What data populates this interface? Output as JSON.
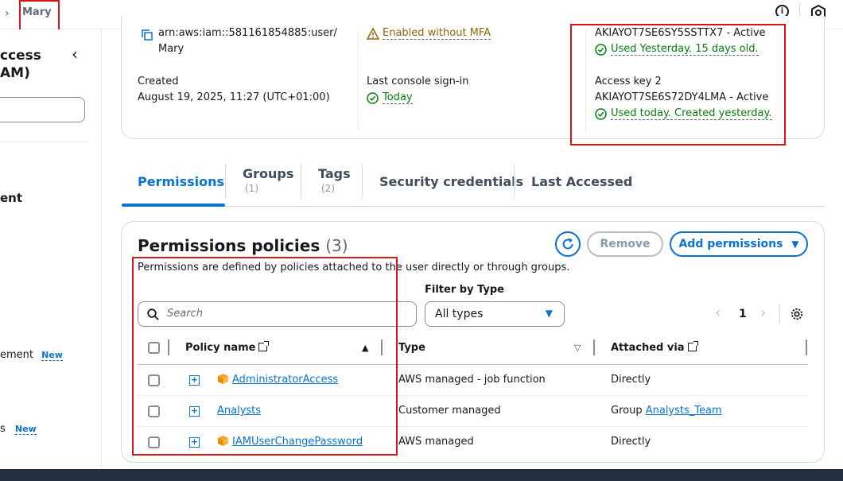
{
  "breadcrumb": {
    "current": "Mary"
  },
  "sidebar": {
    "title_line1": "ccess",
    "title_line2": "AM)",
    "section": "ent",
    "item_a": "ement",
    "item_b": "s",
    "new_badge": "New"
  },
  "summary": {
    "arn_line1": "arn:aws:iam::581161854885:user/",
    "arn_line2": "Mary",
    "mfa_status": "Enabled without MFA",
    "created_label": "Created",
    "created_value": "August 19, 2025, 11:27 (UTC+01:00)",
    "last_signin_label": "Last console sign-in",
    "last_signin_value": "Today",
    "key1_line": "AKIAYOT7SE6SY5SSTTX7 - Active",
    "key1_status": "Used Yesterday. 15 days old.",
    "key2_label": "Access key 2",
    "key2_line": "AKIAYOT7SE6S72DY4LMA - Active",
    "key2_status": "Used today. Created yesterday."
  },
  "tabs": [
    {
      "label": "Permissions",
      "count": ""
    },
    {
      "label": "Groups",
      "count": "(1)"
    },
    {
      "label": "Tags",
      "count": "(2)"
    },
    {
      "label": "Security credentials",
      "count": ""
    },
    {
      "label": "Last Accessed",
      "count": ""
    }
  ],
  "permissions": {
    "title": "Permissions policies",
    "count": "(3)",
    "description": "Permissions are defined by policies attached to the user directly or through groups.",
    "remove_label": "Remove",
    "add_label": "Add permissions",
    "filter_label": "Filter by Type",
    "search_placeholder": "Search",
    "type_selected": "All types",
    "page_number": "1",
    "columns": {
      "policy_name": "Policy name",
      "type": "Type",
      "attached_via": "Attached via"
    },
    "rows": [
      {
        "name": "AdministratorAccess",
        "type": "AWS managed - job function",
        "via_text": "Directly",
        "via_link": ""
      },
      {
        "name": "Analysts",
        "type": "Customer managed",
        "via_text": "Group",
        "via_link": "Analysts_Team"
      },
      {
        "name": "IAMUserChangePassword",
        "type": "AWS managed",
        "via_text": "Directly",
        "via_link": ""
      }
    ]
  },
  "colors": {
    "accent": "#0972d3",
    "success": "#037f0c",
    "warning": "#8d6605",
    "highlight": "#d91515"
  }
}
